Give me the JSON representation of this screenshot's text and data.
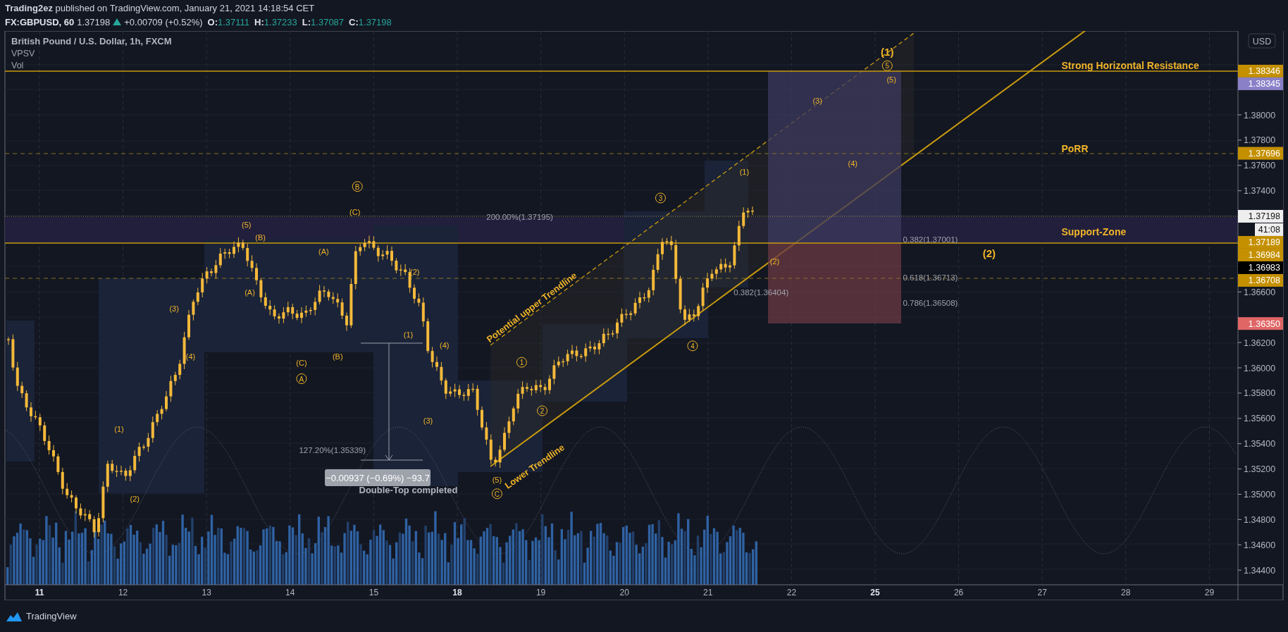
{
  "header": {
    "byline": "**Trading2ez** published on TradingView.com, January 21, 2021 14:18:54 CET",
    "symbol": "FX:GBPUSD, 60",
    "last": "1.37198",
    "change": "+0.00709 (+0.52%)",
    "ohlc": [
      {
        "label": "O:",
        "value": "1.37111"
      },
      {
        "label": "H:",
        "value": "1.37233"
      },
      {
        "label": "L:",
        "value": "1.37087"
      },
      {
        "label": "C:",
        "value": "1.37198"
      }
    ]
  },
  "legend": [
    "British Pound / U.S. Dollar, 1h, FXCM",
    "VPSV",
    "Vol"
  ],
  "currency_button": "USD",
  "price_ticks": [
    "1.38000",
    "1.37800",
    "1.37600",
    "1.37400",
    "1.36600",
    "1.36200",
    "1.36000",
    "1.35800",
    "1.35600",
    "1.35400",
    "1.35200",
    "1.35000",
    "1.34800",
    "1.34600",
    "1.34400"
  ],
  "price_labels": [
    {
      "kind": "price",
      "text": "1.38346",
      "color": "#c49000"
    },
    {
      "kind": "price",
      "text": "1.38345",
      "color": "#8a80c8"
    },
    {
      "kind": "price",
      "text": "1.37696",
      "color": "#c49000"
    },
    {
      "kind": "price",
      "text": "1.37198",
      "color": "#eeeeee"
    },
    {
      "kind": "countdown",
      "text": "41:08",
      "color": "#eeeeee"
    },
    {
      "kind": "price",
      "text": "1.37189",
      "color": "#c49000"
    },
    {
      "kind": "price",
      "text": "1.36984",
      "color": "#c49000"
    },
    {
      "kind": "price",
      "text": "1.36983",
      "color": "#000000"
    },
    {
      "kind": "price",
      "text": "1.36708",
      "color": "#c49000"
    },
    {
      "kind": "price",
      "text": "1.36350",
      "color": "#e06666"
    }
  ],
  "time_labels": [
    {
      "text": "11",
      "week_start": true
    },
    {
      "text": "12",
      "week_start": false
    },
    {
      "text": "13",
      "week_start": false
    },
    {
      "text": "14",
      "week_start": false
    },
    {
      "text": "15",
      "week_start": false
    },
    {
      "text": "18",
      "week_start": true
    },
    {
      "text": "19",
      "week_start": false
    },
    {
      "text": "20",
      "week_start": false
    },
    {
      "text": "21",
      "week_start": false
    },
    {
      "text": "22",
      "week_start": false
    },
    {
      "text": "25",
      "week_start": true
    },
    {
      "text": "26",
      "week_start": false
    },
    {
      "text": "27",
      "week_start": false
    },
    {
      "text": "28",
      "week_start": false
    },
    {
      "text": "29",
      "week_start": false
    }
  ],
  "annotations": [
    {
      "kind": "wave",
      "text": "(1)"
    },
    {
      "kind": "wave",
      "text": "(2)"
    },
    {
      "kind": "wave",
      "text": "(3)"
    },
    {
      "kind": "wave",
      "text": "(4)"
    },
    {
      "kind": "wave",
      "text": "(5)"
    },
    {
      "kind": "wave",
      "text": "(B)"
    },
    {
      "kind": "wave",
      "text": "(A)"
    },
    {
      "kind": "wave",
      "text": "(C)"
    },
    {
      "kind": "circled",
      "text": "A"
    },
    {
      "kind": "wave",
      "text": "(A)"
    },
    {
      "kind": "wave",
      "text": "(B)"
    },
    {
      "kind": "circled",
      "text": "B"
    },
    {
      "kind": "wave",
      "text": "(C)"
    },
    {
      "kind": "wave",
      "text": "(2)"
    },
    {
      "kind": "wave",
      "text": "(1)"
    },
    {
      "kind": "wave",
      "text": "(4)"
    },
    {
      "kind": "wave",
      "text": "(3)"
    },
    {
      "kind": "wave",
      "text": "(5)"
    },
    {
      "kind": "circled",
      "text": "C"
    },
    {
      "kind": "circled",
      "text": "1"
    },
    {
      "kind": "circled",
      "text": "2"
    },
    {
      "kind": "circled",
      "text": "3"
    },
    {
      "kind": "circled",
      "text": "4"
    },
    {
      "kind": "wave",
      "text": "(1)"
    },
    {
      "kind": "wave",
      "text": "(2)"
    },
    {
      "kind": "wave",
      "text": "(3)"
    },
    {
      "kind": "wave",
      "text": "(4)"
    },
    {
      "kind": "major",
      "text": "(1)"
    },
    {
      "kind": "circled",
      "text": "5"
    },
    {
      "kind": "wave",
      "text": "(5)"
    },
    {
      "kind": "major",
      "text": "(2)"
    },
    {
      "kind": "zone",
      "text": "Strong Horizontal Resistance"
    },
    {
      "kind": "zone",
      "text": "PoRR"
    },
    {
      "kind": "zone",
      "text": "Support-Zone"
    },
    {
      "kind": "fib",
      "text": "200.00%(1.37195)"
    },
    {
      "kind": "fib",
      "text": "0.382(1.37001)"
    },
    {
      "kind": "fib",
      "text": "0.618(1.36713)"
    },
    {
      "kind": "fib",
      "text": "0.786(1.36508)"
    },
    {
      "kind": "fib",
      "text": "0.382(1.36404)"
    },
    {
      "kind": "fib",
      "text": "127.20%(1.35339)"
    },
    {
      "kind": "trendline",
      "text": "Potential upper Trendline"
    },
    {
      "kind": "trendline",
      "text": "Lower Trendline"
    },
    {
      "kind": "note",
      "text": "Double-Top completed"
    }
  ],
  "measurement": "−0.00937 (−0.69%) −93.7",
  "footer": {
    "brand": "TradingView"
  }
}
